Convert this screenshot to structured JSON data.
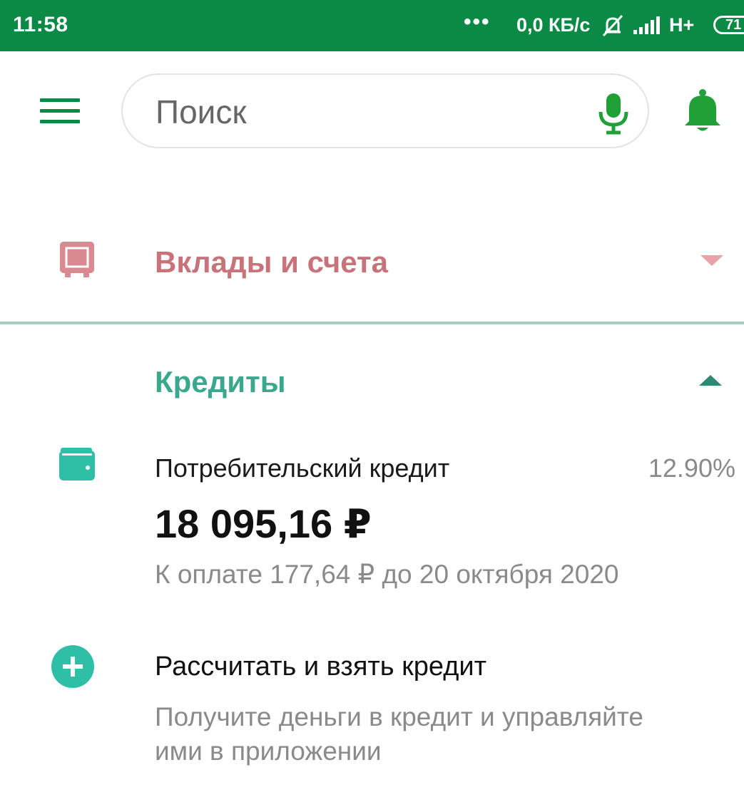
{
  "status_bar": {
    "time": "11:58",
    "dots": "•••",
    "speed": "0,0 КБ/с",
    "network": "H+",
    "battery": "71"
  },
  "search": {
    "placeholder": "Поиск"
  },
  "deposits": {
    "title": "Вклады и счета"
  },
  "credits": {
    "title": "Кредиты",
    "loan": {
      "name": "Потребительский кредит",
      "rate": "12.90%",
      "amount": "18 095,16 ₽",
      "payment": "К оплате 177,64 ₽ до 20 октября 2020"
    },
    "new_loan": {
      "title": "Рассчитать и взять кредит",
      "description": "Получите деньги в кредит и управляйте ими в приложении"
    }
  },
  "colors": {
    "brand_green": "#0b8a45",
    "deposits_accent": "#c8737a",
    "credits_accent": "#3aa88f"
  },
  "icons": {
    "menu": "hamburger-menu-icon",
    "mic": "microphone-icon",
    "bell": "bell-icon",
    "safe": "safe-icon",
    "wallet": "wallet-icon",
    "plus": "plus-circle-icon"
  }
}
